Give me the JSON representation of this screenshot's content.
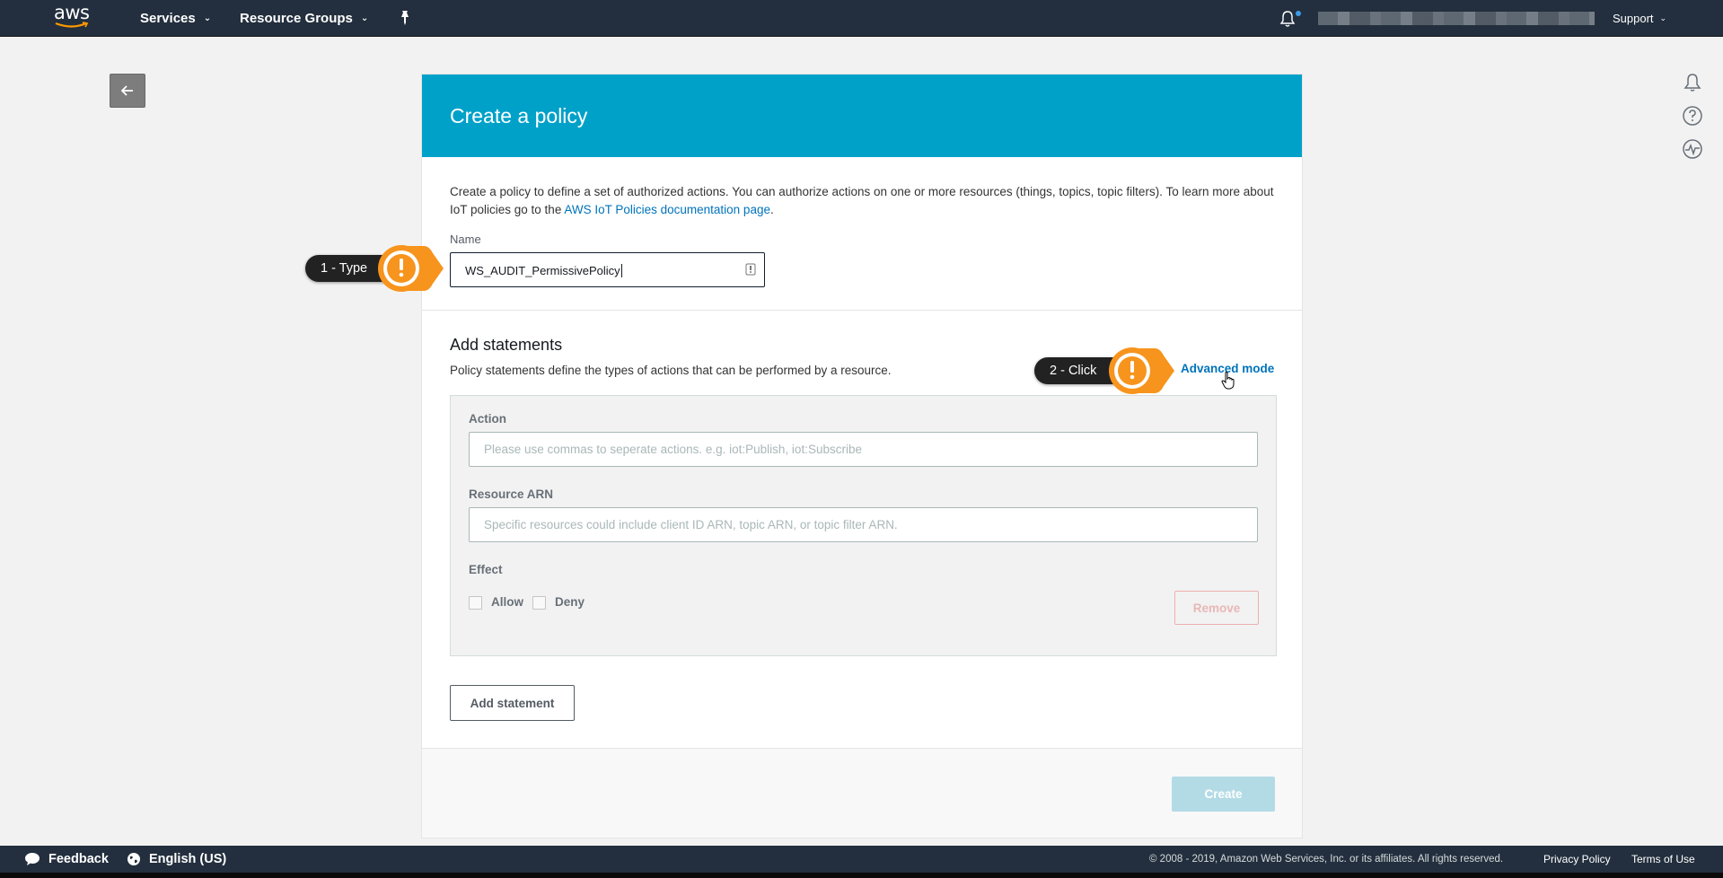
{
  "topnav": {
    "logo_text": "aws",
    "services_label": "Services",
    "resource_groups_label": "Resource Groups",
    "support_label": "Support"
  },
  "panel": {
    "title": "Create a policy",
    "intro_text": "Create a policy to define a set of authorized actions. You can authorize actions on one or more resources (things, topics, topic filters). To learn more about IoT policies go to the ",
    "intro_link": "AWS IoT Policies documentation page",
    "intro_end": ".",
    "name_label": "Name",
    "name_value": "WS_AUDIT_PermissivePolicy"
  },
  "statements": {
    "title": "Add statements",
    "description": "Policy statements define the types of actions that can be performed by a resource.",
    "advanced_mode": "Advanced mode",
    "action_label": "Action",
    "action_placeholder": "Please use commas to seperate actions. e.g. iot:Publish, iot:Subscribe",
    "resource_label": "Resource ARN",
    "resource_placeholder": "Specific resources could include client ID ARN, topic ARN, or topic filter ARN.",
    "effect_label": "Effect",
    "allow_label": "Allow",
    "deny_label": "Deny",
    "remove_label": "Remove",
    "add_statement_label": "Add statement",
    "create_label": "Create"
  },
  "callouts": {
    "step1": "1 - Type",
    "step2": "2 - Click",
    "badge_glyph": "!"
  },
  "footer": {
    "feedback": "Feedback",
    "language": "English (US)",
    "copyright": "© 2008 - 2019, Amazon Web Services, Inc. or its affiliates. All rights reserved.",
    "privacy": "Privacy Policy",
    "terms": "Terms of Use"
  },
  "colors": {
    "nav_bg": "#232f3e",
    "header_blue": "#00a1c9",
    "link_blue": "#0073bb",
    "callout_orange": "#f7941d",
    "callout_dark": "#222222"
  },
  "icons": {
    "pin": "pin-icon",
    "bell": "bell-icon",
    "back": "arrow-left-icon",
    "notifications": "bell-outline-icon",
    "help": "question-circle-icon",
    "health": "pulse-circle-icon",
    "feedback": "speech-bubble-icon",
    "language": "globe-icon",
    "key": "key-icon"
  }
}
